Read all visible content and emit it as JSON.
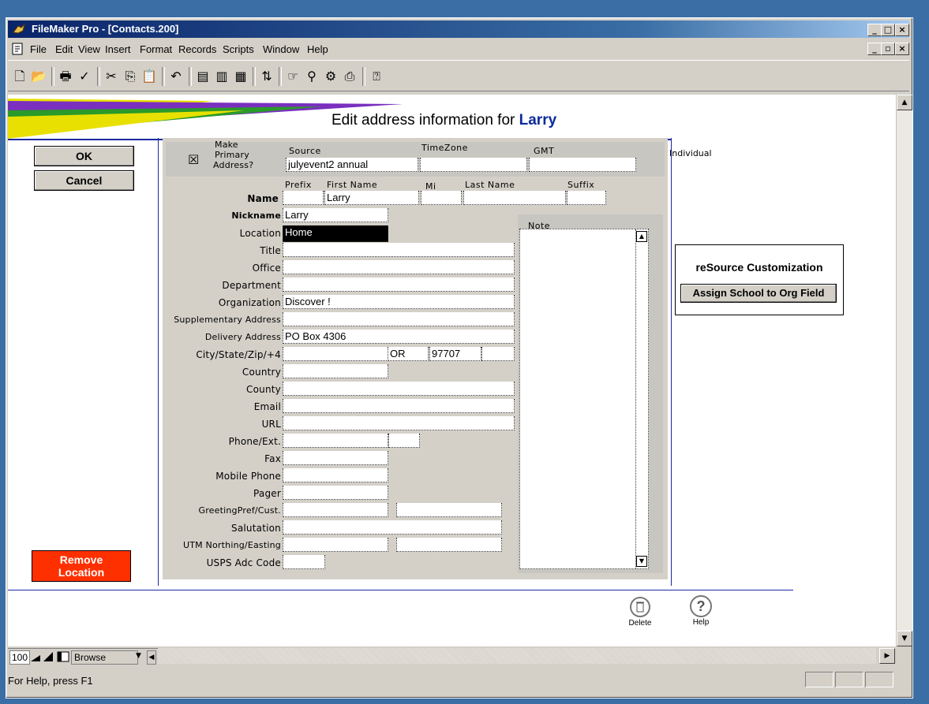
{
  "window": {
    "title": "FileMaker Pro - [Contacts.200]"
  },
  "menu": [
    "File",
    "Edit",
    "View",
    "Insert",
    "Format",
    "Records",
    "Scripts",
    "Window",
    "Help"
  ],
  "toolbar_icons": [
    "new-icon",
    "open-icon",
    "print-icon",
    "spellcheck-icon",
    "cut-icon",
    "copy-icon",
    "paste-icon",
    "undo-icon",
    "new-record-icon",
    "duplicate-record-icon",
    "delete-record-icon",
    "sort-icon",
    "browse-icon",
    "find-icon",
    "layout-icon",
    "preview-icon",
    "help-icon"
  ],
  "layout": {
    "title_prefix": "Edit address information for",
    "title_name": "Larry",
    "ok_label": "OK",
    "cancel_label": "Cancel",
    "remove_label_1": "Remove",
    "remove_label_2": "Location",
    "individual_label": "Individual",
    "customization": {
      "title": "reSource Customization",
      "button": "Assign School to Org Field"
    },
    "delete_label": "Delete",
    "help_label": "Help"
  },
  "form": {
    "primary_label_1": "Make",
    "primary_label_2": "Primary",
    "primary_label_3": "Address?",
    "primary_checked": "☒",
    "source_label": "Source",
    "source_value": "julyevent2 annual",
    "timezone_label": "TimeZone",
    "gmt_label": "GMT",
    "prefix_label": "Prefix",
    "first_label": "First Name",
    "mi_label": "Mi",
    "last_label": "Last Name",
    "suffix_label": "Suffix",
    "name_label": "Name",
    "first_value": "Larry",
    "nickname_label": "Nickname",
    "nickname_value": "Larry",
    "location_label": "Location",
    "location_value": "Home",
    "note_label": "Note",
    "title_label": "Title",
    "office_label": "Office",
    "department_label": "Department",
    "organization_label": "Organization",
    "organization_value": "Discover !",
    "supp_label": "Supplementary Address",
    "delivery_label": "Delivery Address",
    "delivery_value": "PO Box 4306",
    "city_label": "City/State/Zip/+4",
    "state_value": "OR",
    "zip_value": "97707",
    "country_label": "Country",
    "county_label": "County",
    "email_label": "Email",
    "url_label": "URL",
    "phone_label": "Phone/Ext.",
    "fax_label": "Fax",
    "mobile_label": "Mobile Phone",
    "pager_label": "Pager",
    "greeting_label": "GreetingPref/Cust.",
    "salutation_label": "Salutation",
    "utm_label": "UTM Northing/Easting",
    "usps_label": "USPS Adc Code"
  },
  "bottom": {
    "zoom": "100",
    "mode": "Browse",
    "status": "For Help, press F1"
  }
}
